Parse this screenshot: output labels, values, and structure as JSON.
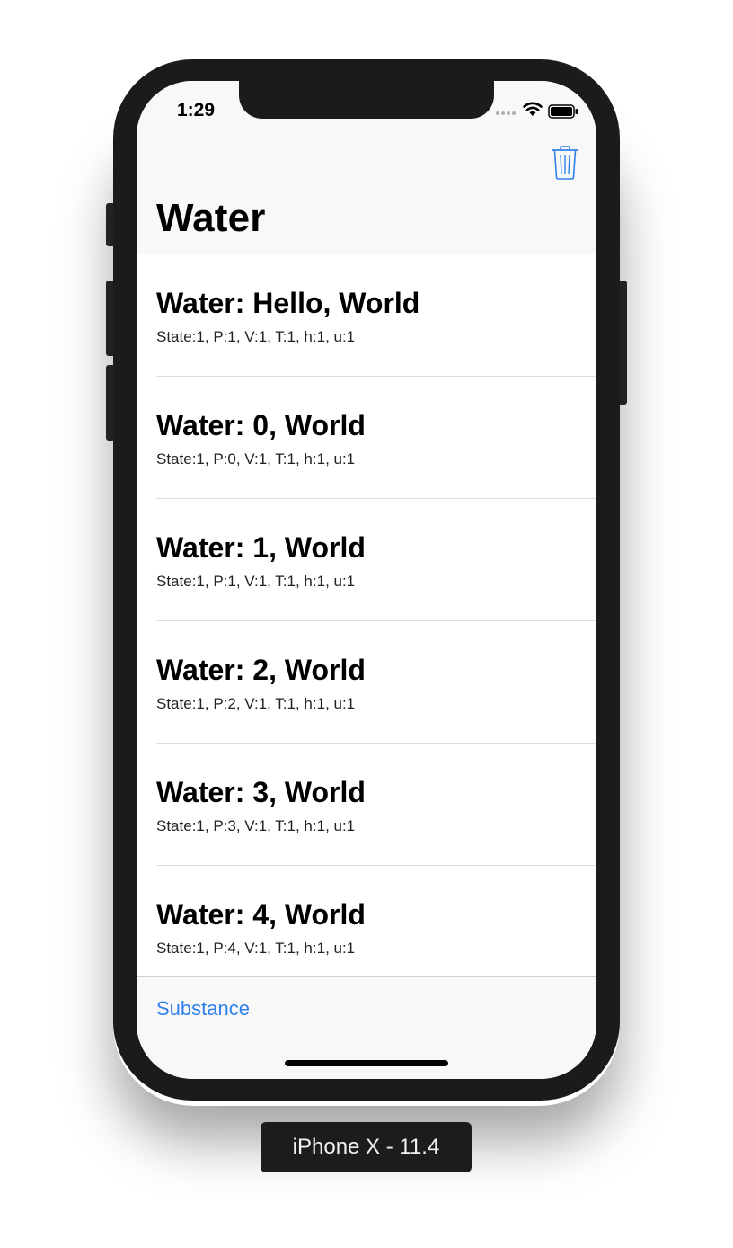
{
  "status_bar": {
    "time": "1:29"
  },
  "navbar": {
    "title": "Water",
    "trash_icon": "trash-icon"
  },
  "rows": [
    {
      "title": "Water: Hello, World",
      "subtitle": "State:1, P:1, V:1, T:1, h:1, u:1"
    },
    {
      "title": "Water: 0, World",
      "subtitle": "State:1, P:0, V:1, T:1, h:1, u:1"
    },
    {
      "title": "Water: 1, World",
      "subtitle": "State:1, P:1, V:1, T:1, h:1, u:1"
    },
    {
      "title": "Water: 2, World",
      "subtitle": "State:1, P:2, V:1, T:1, h:1, u:1"
    },
    {
      "title": "Water: 3, World",
      "subtitle": "State:1, P:3, V:1, T:1, h:1, u:1"
    },
    {
      "title": "Water: 4, World",
      "subtitle": "State:1, P:4, V:1, T:1, h:1, u:1"
    }
  ],
  "toolbar": {
    "link_label": "Substance"
  },
  "device_label": "iPhone X - 11.4",
  "colors": {
    "accent": "#2f80ed",
    "bar_background": "#f8f8f8",
    "bezel": "#1b1b1b"
  }
}
